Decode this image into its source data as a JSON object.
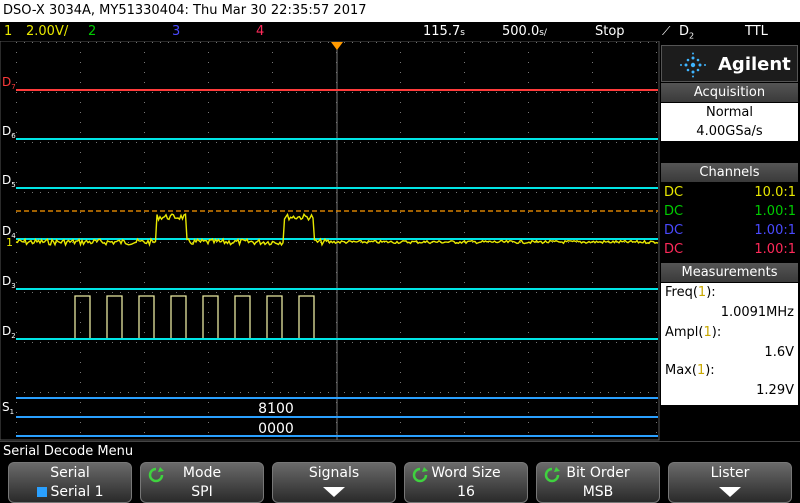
{
  "title_bar": "DSO-X 3034A, MY51330404: Thu Mar 30 22:35:57 2017",
  "status": {
    "ch1_num": "1",
    "ch1_scale": "2.00V/",
    "ch2_num": "2",
    "ch3_num": "3",
    "ch4_num": "4",
    "time_ref": "115.7",
    "time_ref_unit": "s",
    "time_div": "500.0",
    "time_div_unit": "s/",
    "run_state": "Stop",
    "trigger_source": "D",
    "trigger_source_sub": "2",
    "trigger_level": "TTL"
  },
  "channel_labels": {
    "d7": "D",
    "d7_sub": "7",
    "d6": "D",
    "d6_sub": "6",
    "d5": "D",
    "d5_sub": "5",
    "d4": "D",
    "d4_sub": "4",
    "d3": "D",
    "d3_sub": "3",
    "d2": "D",
    "d2_sub": "2",
    "s1": "S",
    "s1_sub": "1",
    "ch1_marker": "1"
  },
  "decode": {
    "row1_value": "8100",
    "row2_value": "0000"
  },
  "right_panel": {
    "brand": "Agilent",
    "acquisition_header": "Acquisition",
    "acq_mode": "Normal",
    "acq_rate": "4.00GSa/s",
    "channels_header": "Channels",
    "channels": [
      {
        "coupling": "DC",
        "probe": "10.0:1",
        "color": "#e8e800"
      },
      {
        "coupling": "DC",
        "probe": "1.00:1",
        "color": "#00cc00"
      },
      {
        "coupling": "DC",
        "probe": "1.00:1",
        "color": "#4a4aff"
      },
      {
        "coupling": "DC",
        "probe": "1.00:1",
        "color": "#ff2a5a"
      }
    ],
    "measurements_header": "Measurements",
    "measurements": [
      {
        "label": "Freq(",
        "src": "1",
        "close": "):",
        "value": "1.0091MHz"
      },
      {
        "label": "Ampl(",
        "src": "1",
        "close": "):",
        "value": "1.6V"
      },
      {
        "label": "Max(",
        "src": "1",
        "close": "):",
        "value": "1.29V"
      }
    ]
  },
  "menu_title": "Serial Decode Menu",
  "softkeys": [
    {
      "label": "Serial",
      "value": "Serial 1"
    },
    {
      "label": "Mode",
      "value": "SPI"
    },
    {
      "label": "Signals",
      "value": ""
    },
    {
      "label": "Word Size",
      "value": "16"
    },
    {
      "label": "Bit Order",
      "value": "MSB"
    },
    {
      "label": "Lister",
      "value": ""
    }
  ],
  "colors": {
    "ch1": "#e8e800",
    "ch2": "#00cc00",
    "ch3": "#4a4aff",
    "ch4": "#ff2a5a",
    "digital": "#00e5e5",
    "serial_bus": "#2aa0ff",
    "orange": "#ff9a00"
  }
}
